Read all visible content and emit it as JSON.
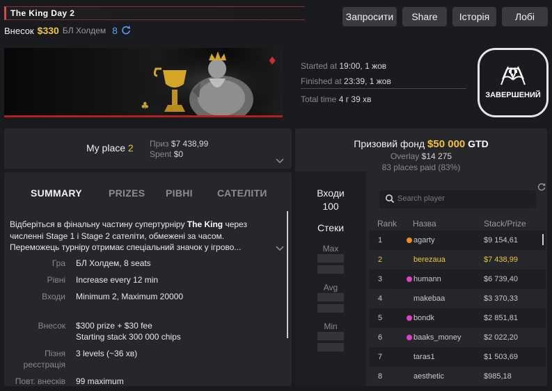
{
  "header": {
    "title": "The King Day 2",
    "buyin_label": "Внесок",
    "buyin_amount": "$330",
    "game": "БЛ Холдем",
    "entrants_count": "8"
  },
  "top_buttons": {
    "request": "Запросити",
    "share": "Share",
    "history": "Історія",
    "lobby": "Лобі"
  },
  "times": {
    "started_label": "Started at",
    "started_value": "19:00, 1 жов",
    "finished_label": "Finished at",
    "finished_value": "23:39, 1 жов",
    "total_label": "Total time",
    "total_value": "4 г 39 хв"
  },
  "status": "ЗАВЕРШЕНИЙ",
  "my_place": {
    "label": "My place",
    "value": "2",
    "prize_label": "Приз",
    "prize_value": "$7 438,99",
    "spent_label": "Spent",
    "spent_value": "$0"
  },
  "tabs": [
    "SUMMARY",
    "PRIZES",
    "РІВНІ",
    "САТЕЛІТИ"
  ],
  "summary": {
    "description_pre": "Відберіться в фінальну частину супертурніру ",
    "description_bold": "The King",
    "description_post": " через численні Stage 1 і Stage 2 сателіти, обмежені за часом. Переможець турніру отримає спеціальний значок у ігрово...",
    "info": [
      {
        "label": "Гра",
        "value": "БЛ Холдем, 8 seats"
      },
      {
        "label": "Рівні",
        "value": "Increase every 12 min"
      },
      {
        "label": "Входи",
        "value": "Minimum 2, Maximum 20000"
      },
      {
        "label": "Внесок",
        "value": "$300 prize + $30 fee",
        "value2": "Starting stack 300 000 chips"
      },
      {
        "label": "Пізня",
        "label2": "реєстрація",
        "value": "3 levels (~36 хв)"
      },
      {
        "label": "Повт. внесків",
        "value": "99 maximum"
      }
    ]
  },
  "prize_pool": {
    "label": "Призовий фонд",
    "amount": "$50 000",
    "gtd": "GTD",
    "overlay_label": "Overlay",
    "overlay_value": "$14 275",
    "places_paid": "83 places paid (83%)"
  },
  "stats": {
    "entries_label": "Входи",
    "entries_value": "100",
    "stacks_label": "Стеки",
    "max_label": "Max",
    "avg_label": "Avg",
    "min_label": "Min"
  },
  "search": {
    "placeholder": "Search player"
  },
  "players_table": {
    "headers": [
      "Rank",
      "Назва",
      "Stack/Prize"
    ],
    "rows": [
      {
        "rank": "1",
        "name": "agarty",
        "stack": "$9 154,61",
        "dot": "#f08a1c"
      },
      {
        "rank": "2",
        "name": "berezaua",
        "stack": "$7 438,99",
        "dot": ""
      },
      {
        "rank": "3",
        "name": "humann",
        "stack": "$6 739,40",
        "dot": "#e040c8"
      },
      {
        "rank": "4",
        "name": "makebaa",
        "stack": "$3 370,33",
        "dot": ""
      },
      {
        "rank": "5",
        "name": "bondk",
        "stack": "$2 851,81",
        "dot": "#e040c8"
      },
      {
        "rank": "6",
        "name": "baaks_money",
        "stack": "$2 022,20",
        "dot": "#e040c8"
      },
      {
        "rank": "7",
        "name": "taras1",
        "stack": "$1 503,69",
        "dot": ""
      },
      {
        "rank": "8",
        "name": "aesthetic",
        "stack": "$985,18",
        "dot": ""
      }
    ]
  },
  "colors": {
    "accent": "#f2c33a",
    "title_bar": "#d24a4a",
    "entrants": "#5aa0ff"
  }
}
